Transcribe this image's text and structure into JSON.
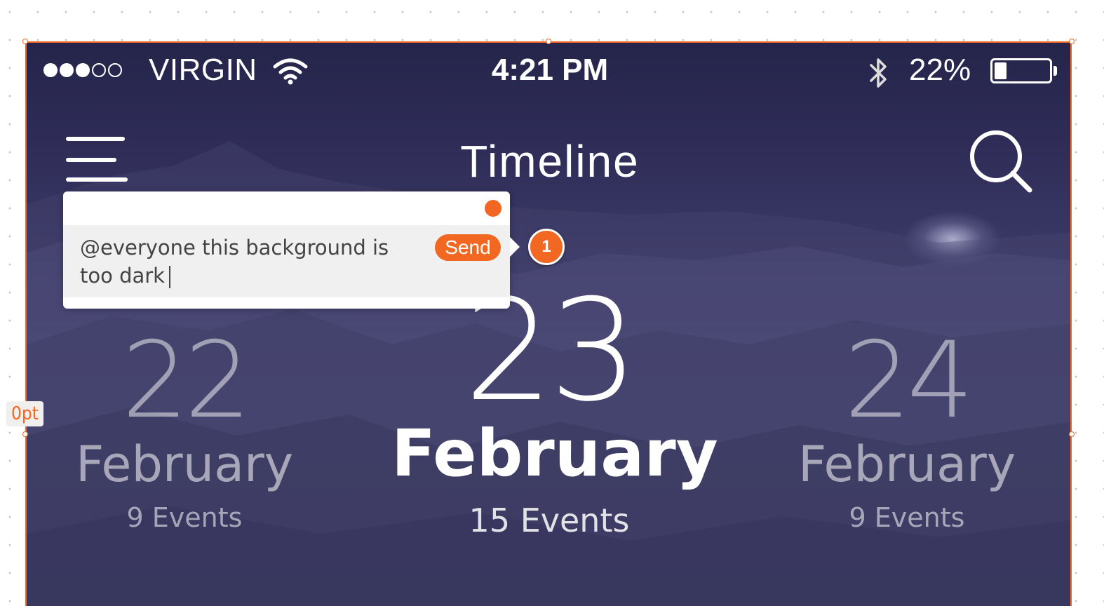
{
  "status_bar": {
    "signal_dots": [
      true,
      true,
      true,
      false,
      false
    ],
    "carrier": "VIRGIN",
    "wifi_icon": "wifi-icon",
    "time": "4:21 PM",
    "bluetooth_icon": "bluetooth-icon",
    "battery_percent": "22%",
    "battery_level": 0.22
  },
  "nav": {
    "menu_icon": "hamburger-menu-icon",
    "title": "Timeline",
    "search_icon": "search-icon"
  },
  "dates": [
    {
      "day": "22",
      "month": "February",
      "events": "9 Events"
    },
    {
      "day": "23",
      "month": "February",
      "events": "15 Events"
    },
    {
      "day": "24",
      "month": "February",
      "events": "9 Events"
    }
  ],
  "comment": {
    "text": "@everyone this background is too dark",
    "send_label": "Send",
    "badge_number": "1"
  },
  "canvas": {
    "spacing_label": "0pt",
    "accent_color": "#f26722"
  }
}
